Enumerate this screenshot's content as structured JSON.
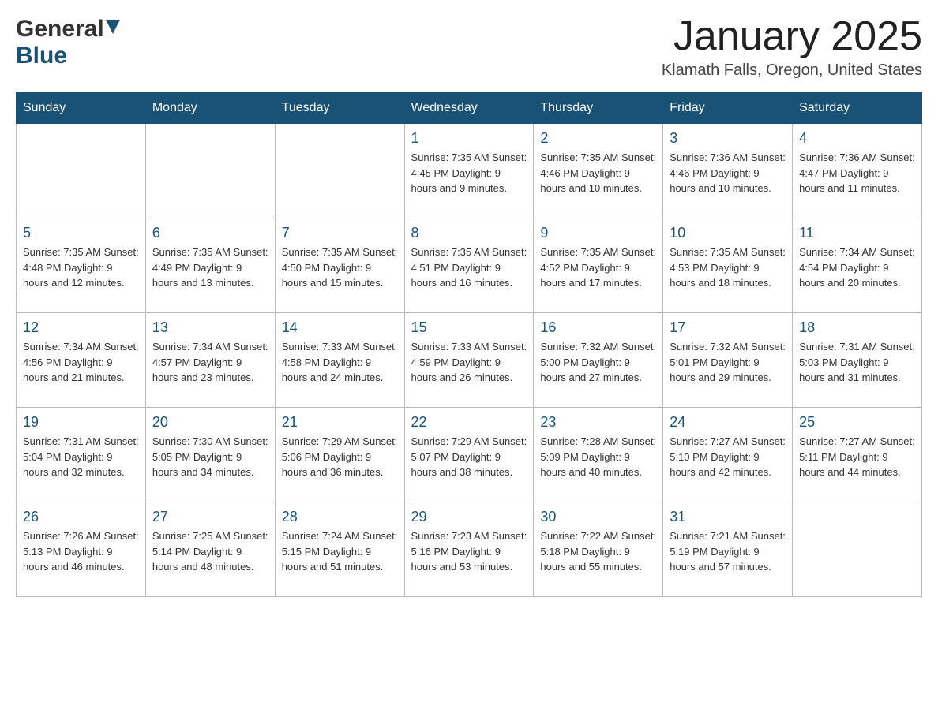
{
  "header": {
    "logo_general": "General",
    "logo_blue": "Blue",
    "month_title": "January 2025",
    "location": "Klamath Falls, Oregon, United States"
  },
  "days_of_week": [
    "Sunday",
    "Monday",
    "Tuesday",
    "Wednesday",
    "Thursday",
    "Friday",
    "Saturday"
  ],
  "weeks": [
    [
      {
        "day": "",
        "info": ""
      },
      {
        "day": "",
        "info": ""
      },
      {
        "day": "",
        "info": ""
      },
      {
        "day": "1",
        "info": "Sunrise: 7:35 AM\nSunset: 4:45 PM\nDaylight: 9 hours\nand 9 minutes."
      },
      {
        "day": "2",
        "info": "Sunrise: 7:35 AM\nSunset: 4:46 PM\nDaylight: 9 hours\nand 10 minutes."
      },
      {
        "day": "3",
        "info": "Sunrise: 7:36 AM\nSunset: 4:46 PM\nDaylight: 9 hours\nand 10 minutes."
      },
      {
        "day": "4",
        "info": "Sunrise: 7:36 AM\nSunset: 4:47 PM\nDaylight: 9 hours\nand 11 minutes."
      }
    ],
    [
      {
        "day": "5",
        "info": "Sunrise: 7:35 AM\nSunset: 4:48 PM\nDaylight: 9 hours\nand 12 minutes."
      },
      {
        "day": "6",
        "info": "Sunrise: 7:35 AM\nSunset: 4:49 PM\nDaylight: 9 hours\nand 13 minutes."
      },
      {
        "day": "7",
        "info": "Sunrise: 7:35 AM\nSunset: 4:50 PM\nDaylight: 9 hours\nand 15 minutes."
      },
      {
        "day": "8",
        "info": "Sunrise: 7:35 AM\nSunset: 4:51 PM\nDaylight: 9 hours\nand 16 minutes."
      },
      {
        "day": "9",
        "info": "Sunrise: 7:35 AM\nSunset: 4:52 PM\nDaylight: 9 hours\nand 17 minutes."
      },
      {
        "day": "10",
        "info": "Sunrise: 7:35 AM\nSunset: 4:53 PM\nDaylight: 9 hours\nand 18 minutes."
      },
      {
        "day": "11",
        "info": "Sunrise: 7:34 AM\nSunset: 4:54 PM\nDaylight: 9 hours\nand 20 minutes."
      }
    ],
    [
      {
        "day": "12",
        "info": "Sunrise: 7:34 AM\nSunset: 4:56 PM\nDaylight: 9 hours\nand 21 minutes."
      },
      {
        "day": "13",
        "info": "Sunrise: 7:34 AM\nSunset: 4:57 PM\nDaylight: 9 hours\nand 23 minutes."
      },
      {
        "day": "14",
        "info": "Sunrise: 7:33 AM\nSunset: 4:58 PM\nDaylight: 9 hours\nand 24 minutes."
      },
      {
        "day": "15",
        "info": "Sunrise: 7:33 AM\nSunset: 4:59 PM\nDaylight: 9 hours\nand 26 minutes."
      },
      {
        "day": "16",
        "info": "Sunrise: 7:32 AM\nSunset: 5:00 PM\nDaylight: 9 hours\nand 27 minutes."
      },
      {
        "day": "17",
        "info": "Sunrise: 7:32 AM\nSunset: 5:01 PM\nDaylight: 9 hours\nand 29 minutes."
      },
      {
        "day": "18",
        "info": "Sunrise: 7:31 AM\nSunset: 5:03 PM\nDaylight: 9 hours\nand 31 minutes."
      }
    ],
    [
      {
        "day": "19",
        "info": "Sunrise: 7:31 AM\nSunset: 5:04 PM\nDaylight: 9 hours\nand 32 minutes."
      },
      {
        "day": "20",
        "info": "Sunrise: 7:30 AM\nSunset: 5:05 PM\nDaylight: 9 hours\nand 34 minutes."
      },
      {
        "day": "21",
        "info": "Sunrise: 7:29 AM\nSunset: 5:06 PM\nDaylight: 9 hours\nand 36 minutes."
      },
      {
        "day": "22",
        "info": "Sunrise: 7:29 AM\nSunset: 5:07 PM\nDaylight: 9 hours\nand 38 minutes."
      },
      {
        "day": "23",
        "info": "Sunrise: 7:28 AM\nSunset: 5:09 PM\nDaylight: 9 hours\nand 40 minutes."
      },
      {
        "day": "24",
        "info": "Sunrise: 7:27 AM\nSunset: 5:10 PM\nDaylight: 9 hours\nand 42 minutes."
      },
      {
        "day": "25",
        "info": "Sunrise: 7:27 AM\nSunset: 5:11 PM\nDaylight: 9 hours\nand 44 minutes."
      }
    ],
    [
      {
        "day": "26",
        "info": "Sunrise: 7:26 AM\nSunset: 5:13 PM\nDaylight: 9 hours\nand 46 minutes."
      },
      {
        "day": "27",
        "info": "Sunrise: 7:25 AM\nSunset: 5:14 PM\nDaylight: 9 hours\nand 48 minutes."
      },
      {
        "day": "28",
        "info": "Sunrise: 7:24 AM\nSunset: 5:15 PM\nDaylight: 9 hours\nand 51 minutes."
      },
      {
        "day": "29",
        "info": "Sunrise: 7:23 AM\nSunset: 5:16 PM\nDaylight: 9 hours\nand 53 minutes."
      },
      {
        "day": "30",
        "info": "Sunrise: 7:22 AM\nSunset: 5:18 PM\nDaylight: 9 hours\nand 55 minutes."
      },
      {
        "day": "31",
        "info": "Sunrise: 7:21 AM\nSunset: 5:19 PM\nDaylight: 9 hours\nand 57 minutes."
      },
      {
        "day": "",
        "info": ""
      }
    ]
  ]
}
